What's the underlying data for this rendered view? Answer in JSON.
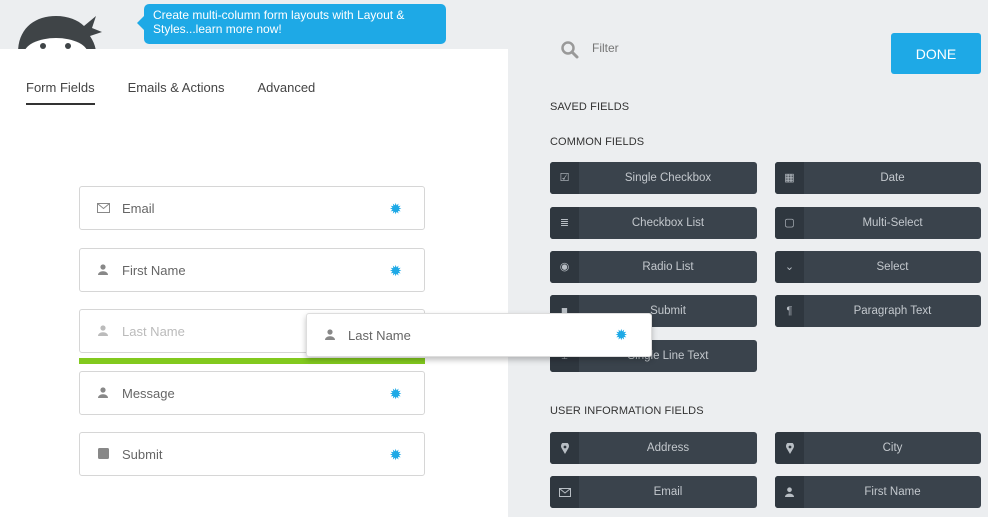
{
  "banner": {
    "tooltip_text": "Create multi-column form layouts with Layout & Styles...learn more now!"
  },
  "tabs": [
    {
      "label": "Form Fields",
      "active": true
    },
    {
      "label": "Emails & Actions",
      "active": false
    },
    {
      "label": "Advanced",
      "active": false
    }
  ],
  "form_fields": [
    {
      "label": "Email",
      "icon": "envelope-icon"
    },
    {
      "label": "First Name",
      "icon": "user-icon"
    },
    {
      "label": "Last Name",
      "icon": "user-icon",
      "placeholder_ghost": true
    },
    {
      "label": "Message",
      "icon": "user-icon"
    },
    {
      "label": "Submit",
      "icon": "square-icon"
    }
  ],
  "dragging_field": {
    "label": "Last Name",
    "icon": "user-icon"
  },
  "filter": {
    "placeholder": "Filter",
    "value": ""
  },
  "done_label": "DONE",
  "sections": {
    "saved": "SAVED FIELDS",
    "common": "COMMON FIELDS",
    "user_info": "USER INFORMATION FIELDS"
  },
  "common_fields": [
    {
      "label": "Single Checkbox",
      "icon": "checkbox-icon"
    },
    {
      "label": "Date",
      "icon": "calendar-icon"
    },
    {
      "label": "Checkbox List",
      "icon": "list-icon"
    },
    {
      "label": "Multi-Select",
      "icon": "square-outline-icon"
    },
    {
      "label": "Radio List",
      "icon": "radio-icon"
    },
    {
      "label": "Select",
      "icon": "chevron-down-icon"
    },
    {
      "label": "Submit",
      "icon": "square-icon"
    },
    {
      "label": "Paragraph Text",
      "icon": "paragraph-icon"
    },
    {
      "label": "Single Line Text",
      "icon": "text-cursor-icon"
    }
  ],
  "user_info_fields": [
    {
      "label": "Address",
      "icon": "map-marker-icon"
    },
    {
      "label": "City",
      "icon": "map-marker-icon"
    },
    {
      "label": "Email",
      "icon": "envelope-icon"
    },
    {
      "label": "First Name",
      "icon": "user-icon"
    }
  ],
  "colors": {
    "accent": "#1ea9e6",
    "drop_indicator": "#82c91e",
    "field_button_bg": "#3a434c",
    "panel_bg": "#eceef0"
  }
}
